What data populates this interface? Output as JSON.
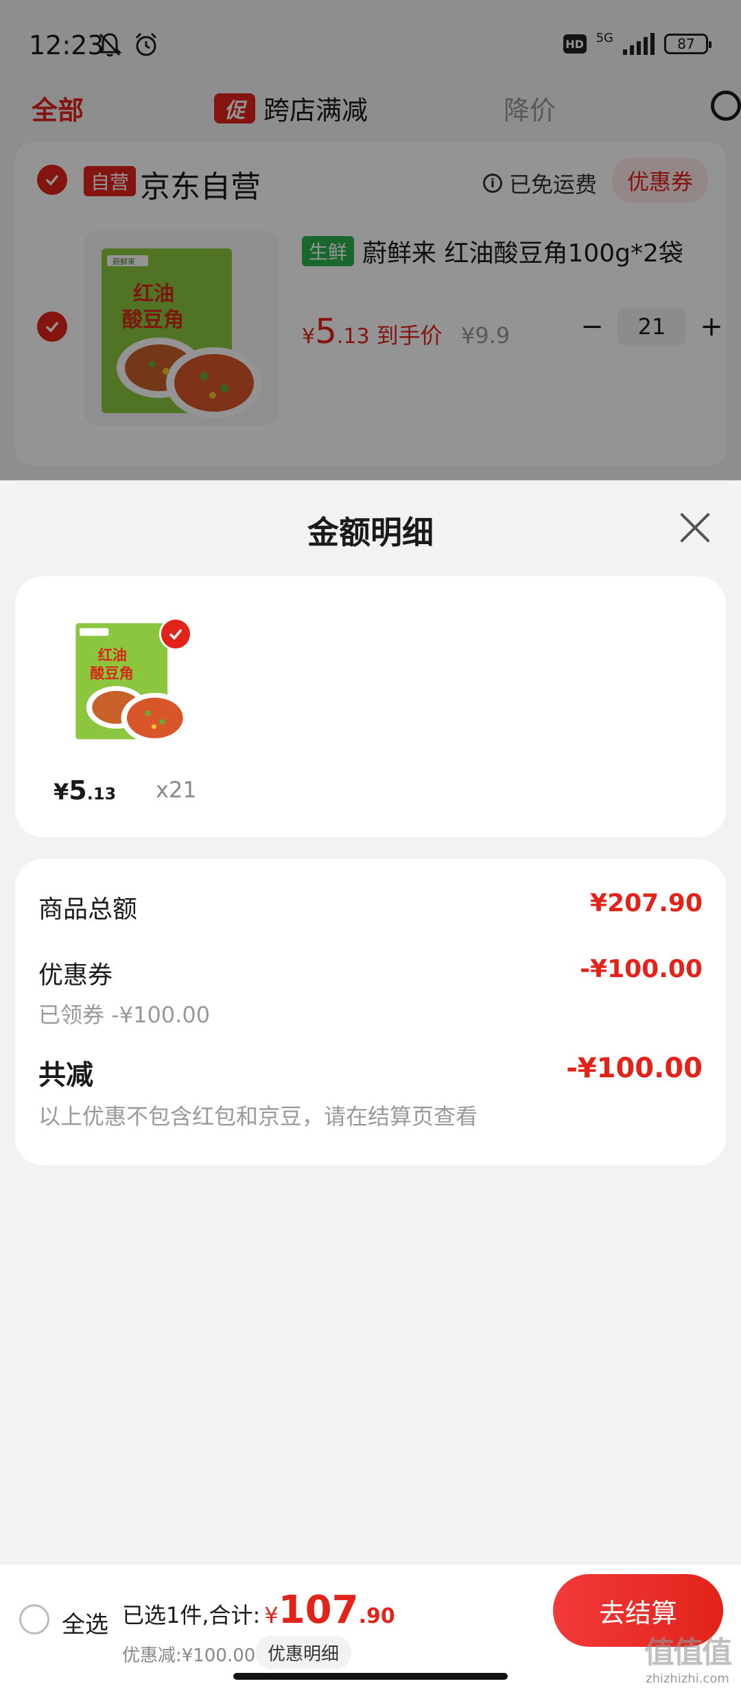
{
  "status_bar": {
    "time": "12:23",
    "network": "5G",
    "hd": "HD",
    "battery": "87",
    "icons": [
      "mute-bell-icon",
      "alarm-icon",
      "signal-icon",
      "battery-icon"
    ]
  },
  "tabs": {
    "all": "全部",
    "promo_tag": "促",
    "promo": "跨店满减",
    "price_drop": "降价"
  },
  "store": {
    "self_tag": "自营",
    "name": "京东自营",
    "free_shipping": "已免运费",
    "coupon": "优惠券"
  },
  "product": {
    "fresh_tag": "生鲜",
    "title": "蔚鲜来 红油酸豆角100g*2袋",
    "price_symbol": "¥",
    "price_int": "5",
    "price_dec": ".13",
    "price_suffix": "到手价",
    "original_price": "¥9.9",
    "quantity": "21",
    "minus": "−",
    "plus": "+",
    "package_brand": "蔚鲜来",
    "package_line1": "红油",
    "package_line2": "酸豆角"
  },
  "sheet": {
    "title": "金额明细",
    "goods": {
      "price_symbol": "¥",
      "price_int": "5",
      "price_dec": ".13",
      "qty": "x21"
    },
    "rows": {
      "subtotal_label": "商品总额",
      "subtotal_value": "¥207.90",
      "coupon_label": "优惠券",
      "coupon_value": "-¥100.00",
      "coupon_sub": "已领券 -¥100.00",
      "total_label": "共减",
      "total_value": "-¥100.00",
      "note": "以上优惠不包含红包和京豆，请在结算页查看"
    }
  },
  "bottom_bar": {
    "select_all": "全选",
    "summary": "已选1件,合计:",
    "total_symbol": "¥",
    "total_int": "107",
    "total_dec": ".90",
    "discount": "优惠减:¥100.00",
    "detail_button": "优惠明细",
    "checkout": "去结算",
    "watermark_domain": "zhizhizhi.com"
  },
  "colors": {
    "accent": "#e2231a",
    "fresh": "#2bb24c",
    "background": "#f2f2f2"
  }
}
